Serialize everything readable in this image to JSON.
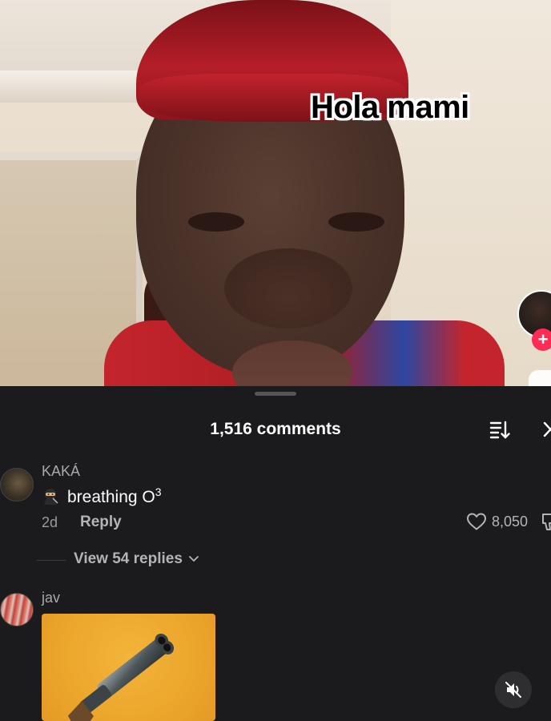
{
  "video": {
    "caption": "Hola mami",
    "follow_symbol": "+"
  },
  "comments_panel": {
    "count_label": "1,516 comments",
    "sort_icon": "sort-icon",
    "close_icon": "close-icon"
  },
  "comments": [
    {
      "username": "KAKÁ",
      "emoji_icon": "ninja-emoji",
      "text_main": "breathing O",
      "text_sup": "3",
      "age": "2d",
      "reply_label": "Reply",
      "like_count": "8,050",
      "view_replies_label": "View 54 replies"
    },
    {
      "username": "jav",
      "attachment": "gif-shotgun-icon"
    }
  ],
  "controls": {
    "mute_icon": "mute-icon"
  }
}
